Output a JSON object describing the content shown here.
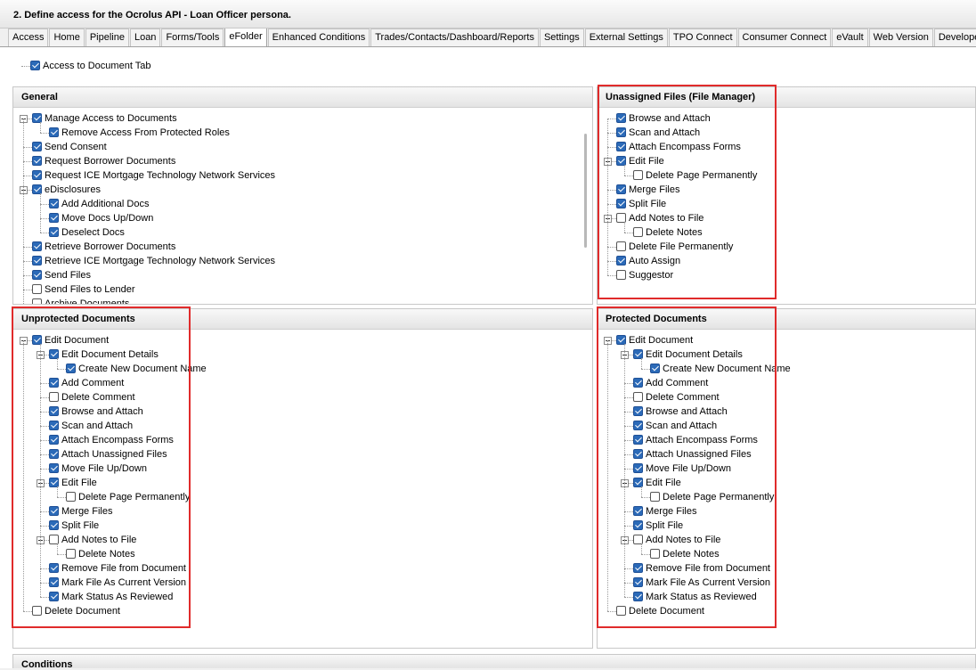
{
  "window_title": "2. Define access for the Ocrolus API - Loan Officer persona.",
  "tabs": [
    "Access",
    "Home",
    "Pipeline",
    "Loan",
    "Forms/Tools",
    "eFolder",
    "Enhanced Conditions",
    "Trades/Contacts/Dashboard/Reports",
    "Settings",
    "External Settings",
    "TPO Connect",
    "Consumer Connect",
    "eVault",
    "Web Version",
    "Develope"
  ],
  "active_tab": "eFolder",
  "access_doc_tab": {
    "label": "Access to Document Tab",
    "checked": true
  },
  "panels": {
    "general": {
      "title": "General",
      "items": [
        {
          "label": "Manage Access to Documents",
          "level": 0,
          "checked": true,
          "expander": true
        },
        {
          "label": "Remove Access From Protected Roles",
          "level": 1,
          "checked": true
        },
        {
          "label": "Send Consent",
          "level": 0,
          "checked": true
        },
        {
          "label": "Request Borrower Documents",
          "level": 0,
          "checked": true
        },
        {
          "label": "Request ICE Mortgage Technology Network Services",
          "level": 0,
          "checked": true
        },
        {
          "label": "eDisclosures",
          "level": 0,
          "checked": true,
          "expander": true
        },
        {
          "label": "Add Additional Docs",
          "level": 1,
          "checked": true
        },
        {
          "label": "Move Docs Up/Down",
          "level": 1,
          "checked": true
        },
        {
          "label": "Deselect Docs",
          "level": 1,
          "checked": true
        },
        {
          "label": "Retrieve Borrower Documents",
          "level": 0,
          "checked": true
        },
        {
          "label": "Retrieve ICE Mortgage Technology Network Services",
          "level": 0,
          "checked": true
        },
        {
          "label": "Send Files",
          "level": 0,
          "checked": true
        },
        {
          "label": "Send Files to Lender",
          "level": 0,
          "checked": false
        },
        {
          "label": "Archive Documents",
          "level": 0,
          "checked": false
        }
      ]
    },
    "unassigned": {
      "title": "Unassigned Files (File Manager)",
      "items": [
        {
          "label": "Browse and Attach",
          "level": 0,
          "checked": true
        },
        {
          "label": "Scan and Attach",
          "level": 0,
          "checked": true
        },
        {
          "label": "Attach Encompass Forms",
          "level": 0,
          "checked": true
        },
        {
          "label": "Edit File",
          "level": 0,
          "checked": true,
          "expander": true
        },
        {
          "label": "Delete Page Permanently",
          "level": 1,
          "checked": false
        },
        {
          "label": "Merge Files",
          "level": 0,
          "checked": true
        },
        {
          "label": "Split File",
          "level": 0,
          "checked": true
        },
        {
          "label": "Add Notes to File",
          "level": 0,
          "checked": false,
          "expander": true
        },
        {
          "label": "Delete Notes",
          "level": 1,
          "checked": false
        },
        {
          "label": "Delete File Permanently",
          "level": 0,
          "checked": false
        },
        {
          "label": "Auto Assign",
          "level": 0,
          "checked": true
        },
        {
          "label": "Suggestor",
          "level": 0,
          "checked": false
        }
      ]
    },
    "unprotected": {
      "title": "Unprotected Documents",
      "items": [
        {
          "label": "Edit Document",
          "level": 0,
          "checked": true,
          "expander": true
        },
        {
          "label": "Edit Document Details",
          "level": 1,
          "checked": true,
          "expander": true
        },
        {
          "label": "Create New Document Name",
          "level": 2,
          "checked": true
        },
        {
          "label": "Add Comment",
          "level": 1,
          "checked": true
        },
        {
          "label": "Delete Comment",
          "level": 1,
          "checked": false
        },
        {
          "label": "Browse and Attach",
          "level": 1,
          "checked": true
        },
        {
          "label": "Scan and Attach",
          "level": 1,
          "checked": true
        },
        {
          "label": "Attach Encompass Forms",
          "level": 1,
          "checked": true
        },
        {
          "label": "Attach Unassigned Files",
          "level": 1,
          "checked": true
        },
        {
          "label": "Move File Up/Down",
          "level": 1,
          "checked": true
        },
        {
          "label": "Edit File",
          "level": 1,
          "checked": true,
          "expander": true
        },
        {
          "label": "Delete Page Permanently",
          "level": 2,
          "checked": false
        },
        {
          "label": "Merge Files",
          "level": 1,
          "checked": true
        },
        {
          "label": "Split File",
          "level": 1,
          "checked": true
        },
        {
          "label": "Add Notes to File",
          "level": 1,
          "checked": false,
          "expander": true
        },
        {
          "label": "Delete Notes",
          "level": 2,
          "checked": false
        },
        {
          "label": "Remove File from Document",
          "level": 1,
          "checked": true
        },
        {
          "label": "Mark File As Current Version",
          "level": 1,
          "checked": true
        },
        {
          "label": "Mark Status As Reviewed",
          "level": 1,
          "checked": true
        },
        {
          "label": "Delete Document",
          "level": 0,
          "checked": false
        }
      ]
    },
    "protected": {
      "title": "Protected Documents",
      "items": [
        {
          "label": "Edit Document",
          "level": 0,
          "checked": true,
          "expander": true
        },
        {
          "label": "Edit Document Details",
          "level": 1,
          "checked": true,
          "expander": true
        },
        {
          "label": "Create New Document Name",
          "level": 2,
          "checked": true
        },
        {
          "label": "Add Comment",
          "level": 1,
          "checked": true
        },
        {
          "label": "Delete Comment",
          "level": 1,
          "checked": false
        },
        {
          "label": "Browse and Attach",
          "level": 1,
          "checked": true
        },
        {
          "label": "Scan and Attach",
          "level": 1,
          "checked": true
        },
        {
          "label": "Attach Encompass Forms",
          "level": 1,
          "checked": true
        },
        {
          "label": "Attach Unassigned Files",
          "level": 1,
          "checked": true
        },
        {
          "label": "Move File Up/Down",
          "level": 1,
          "checked": true
        },
        {
          "label": "Edit File",
          "level": 1,
          "checked": true,
          "expander": true
        },
        {
          "label": "Delete Page Permanently",
          "level": 2,
          "checked": false
        },
        {
          "label": "Merge Files",
          "level": 1,
          "checked": true
        },
        {
          "label": "Split File",
          "level": 1,
          "checked": true
        },
        {
          "label": "Add Notes to File",
          "level": 1,
          "checked": false,
          "expander": true
        },
        {
          "label": "Delete Notes",
          "level": 2,
          "checked": false
        },
        {
          "label": "Remove File from Document",
          "level": 1,
          "checked": true
        },
        {
          "label": "Mark File As Current Version",
          "level": 1,
          "checked": true
        },
        {
          "label": "Mark Status as Reviewed",
          "level": 1,
          "checked": true
        },
        {
          "label": "Delete Document",
          "level": 0,
          "checked": false
        }
      ]
    },
    "conditions": {
      "title": "Conditions"
    }
  },
  "colors": {
    "checkbox_checked": "#2b6ab8",
    "highlight_border": "#e02b2b"
  }
}
